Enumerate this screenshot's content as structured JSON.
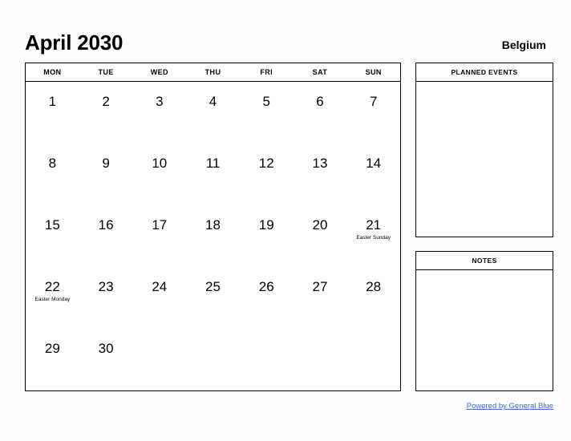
{
  "header": {
    "title": "April 2030",
    "country": "Belgium"
  },
  "calendar": {
    "weekdays": [
      "MON",
      "TUE",
      "WED",
      "THU",
      "FRI",
      "SAT",
      "SUN"
    ],
    "weeks": [
      [
        {
          "day": "1",
          "event": ""
        },
        {
          "day": "2",
          "event": ""
        },
        {
          "day": "3",
          "event": ""
        },
        {
          "day": "4",
          "event": ""
        },
        {
          "day": "5",
          "event": ""
        },
        {
          "day": "6",
          "event": ""
        },
        {
          "day": "7",
          "event": ""
        }
      ],
      [
        {
          "day": "8",
          "event": ""
        },
        {
          "day": "9",
          "event": ""
        },
        {
          "day": "10",
          "event": ""
        },
        {
          "day": "11",
          "event": ""
        },
        {
          "day": "12",
          "event": ""
        },
        {
          "day": "13",
          "event": ""
        },
        {
          "day": "14",
          "event": ""
        }
      ],
      [
        {
          "day": "15",
          "event": ""
        },
        {
          "day": "16",
          "event": ""
        },
        {
          "day": "17",
          "event": ""
        },
        {
          "day": "18",
          "event": ""
        },
        {
          "day": "19",
          "event": ""
        },
        {
          "day": "20",
          "event": ""
        },
        {
          "day": "21",
          "event": "Easter Sunday"
        }
      ],
      [
        {
          "day": "22",
          "event": "Easter Monday"
        },
        {
          "day": "23",
          "event": ""
        },
        {
          "day": "24",
          "event": ""
        },
        {
          "day": "25",
          "event": ""
        },
        {
          "day": "26",
          "event": ""
        },
        {
          "day": "27",
          "event": ""
        },
        {
          "day": "28",
          "event": ""
        }
      ],
      [
        {
          "day": "29",
          "event": ""
        },
        {
          "day": "30",
          "event": ""
        },
        {
          "day": "",
          "event": ""
        },
        {
          "day": "",
          "event": ""
        },
        {
          "day": "",
          "event": ""
        },
        {
          "day": "",
          "event": ""
        },
        {
          "day": "",
          "event": ""
        }
      ]
    ]
  },
  "panels": {
    "planned_events": {
      "title": "PLANNED EVENTS",
      "content": ""
    },
    "notes": {
      "title": "NOTES",
      "content": ""
    }
  },
  "footer": {
    "link_text": "Powered by General Blue"
  },
  "colors": {
    "text": "#000000",
    "border": "#000000",
    "link": "#3a6fd0",
    "page_background": "#fdfdfd",
    "panel_background": "#ffffff"
  }
}
